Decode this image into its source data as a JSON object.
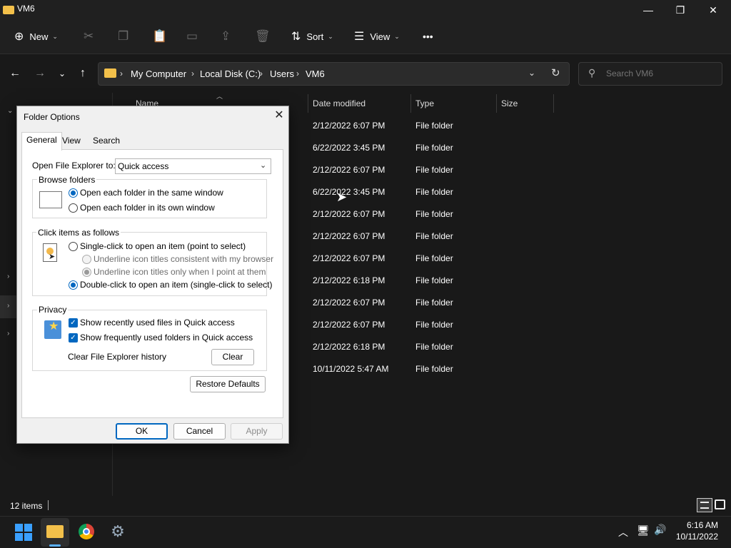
{
  "window": {
    "title": "VM6",
    "controls": {
      "minimize": "—",
      "restore": "❐",
      "close": "✕"
    }
  },
  "toolbar": {
    "new_label": "New",
    "sort_label": "Sort",
    "view_label": "View",
    "more_label": "•••"
  },
  "address": {
    "crumbs": [
      "My Computer",
      "Local Disk (C:)",
      "Users",
      "VM6"
    ],
    "search_placeholder": "Search VM6"
  },
  "columns": {
    "name": "Name",
    "date": "Date modified",
    "type": "Type",
    "size": "Size"
  },
  "rows": [
    {
      "date": "2/12/2022 6:07 PM",
      "type": "File folder"
    },
    {
      "date": "6/22/2022 3:45 PM",
      "type": "File folder"
    },
    {
      "date": "2/12/2022 6:07 PM",
      "type": "File folder"
    },
    {
      "date": "6/22/2022 3:45 PM",
      "type": "File folder"
    },
    {
      "date": "2/12/2022 6:07 PM",
      "type": "File folder"
    },
    {
      "date": "2/12/2022 6:07 PM",
      "type": "File folder"
    },
    {
      "date": "2/12/2022 6:07 PM",
      "type": "File folder"
    },
    {
      "date": "2/12/2022 6:18 PM",
      "type": "File folder"
    },
    {
      "date": "2/12/2022 6:07 PM",
      "type": "File folder"
    },
    {
      "date": "2/12/2022 6:07 PM",
      "type": "File folder"
    },
    {
      "date": "2/12/2022 6:18 PM",
      "type": "File folder"
    },
    {
      "date": "10/11/2022 5:47 AM",
      "type": "File folder"
    }
  ],
  "status": {
    "items": "12 items"
  },
  "dialog": {
    "title": "Folder Options",
    "tabs": [
      "General",
      "View",
      "Search"
    ],
    "open_to_label": "Open File Explorer to:",
    "open_to_value": "Quick access",
    "browse": {
      "title": "Browse folders",
      "opt_same": "Open each folder in the same window",
      "opt_own": "Open each folder in its own window"
    },
    "click": {
      "title": "Click items as follows",
      "opt_single": "Single-click to open an item (point to select)",
      "opt_underline_browser": "Underline icon titles consistent with my browser",
      "opt_underline_point": "Underline icon titles only when I point at them",
      "opt_double": "Double-click to open an item (single-click to select)"
    },
    "privacy": {
      "title": "Privacy",
      "opt_recent_files": "Show recently used files in Quick access",
      "opt_frequent_folders": "Show frequently used folders in Quick access",
      "clear_history_label": "Clear File Explorer history",
      "clear_button": "Clear"
    },
    "restore_defaults": "Restore Defaults",
    "ok": "OK",
    "cancel": "Cancel",
    "apply": "Apply"
  },
  "clock": {
    "time": "6:16 AM",
    "date": "10/11/2022"
  },
  "colors": {
    "accent": "#0067c0",
    "folder": "#f3c04a",
    "dark_bg": "#191919"
  }
}
